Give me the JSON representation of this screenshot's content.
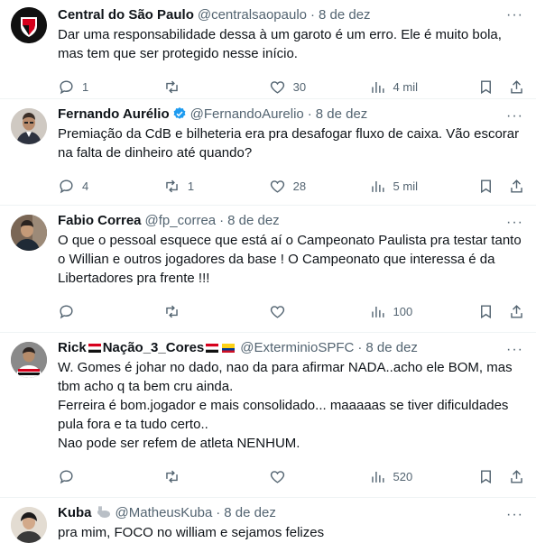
{
  "tweets": [
    {
      "name": "Central do São Paulo",
      "handle": "@centralsaopaulo",
      "date": "8 de dez",
      "text": "Dar uma responsabilidade dessa à um garoto é um erro. Ele é muito bola, mas tem que ser protegido nesse início.",
      "replies": "1",
      "retweets": "",
      "likes": "30",
      "views": "4 mil"
    },
    {
      "name": "Fernando Aurélio",
      "handle": "@FernandoAurelio",
      "date": "8 de dez",
      "text": "Premiação da CdB e bilheteria era pra desafogar fluxo de caixa. Vão escorar na falta de dinheiro até quando?",
      "replies": "4",
      "retweets": "1",
      "likes": "28",
      "views": "5 mil"
    },
    {
      "name": "Fabio Correa",
      "handle": "@fp_correa",
      "date": "8 de dez",
      "text": "O que o pessoal esquece que está aí o Campeonato Paulista pra testar tanto o Willian e outros jogadores da base ! O Campeonato que interessa é da Libertadores pra frente !!!",
      "replies": "",
      "retweets": "",
      "likes": "",
      "views": "100"
    },
    {
      "name_a": "Rick",
      "name_b": "Nação_3_Cores",
      "handle": "@ExterminioSPFC",
      "date": "8 de dez",
      "text": "W. Gomes é johar no dado, nao da para afirmar NADA..acho ele BOM, mas\ntbm acho q ta bem cru ainda.\nFerreira é bom.jogador e mais consolidado... maaaaas se tiver dificuldades\npula fora e ta tudo certo..\nNao pode ser refem de atleta NENHUM.",
      "replies": "",
      "retweets": "",
      "likes": "",
      "views": "520"
    },
    {
      "name": "Kuba",
      "handle": "@MatheusKuba",
      "date": "8 de dez",
      "text": "pra mim, FOCO no william e sejamos felizes"
    }
  ],
  "colors": {
    "accent": "#1d9bf0",
    "muted": "#536471",
    "text": "#0f1419",
    "divider": "#eff3f4"
  }
}
